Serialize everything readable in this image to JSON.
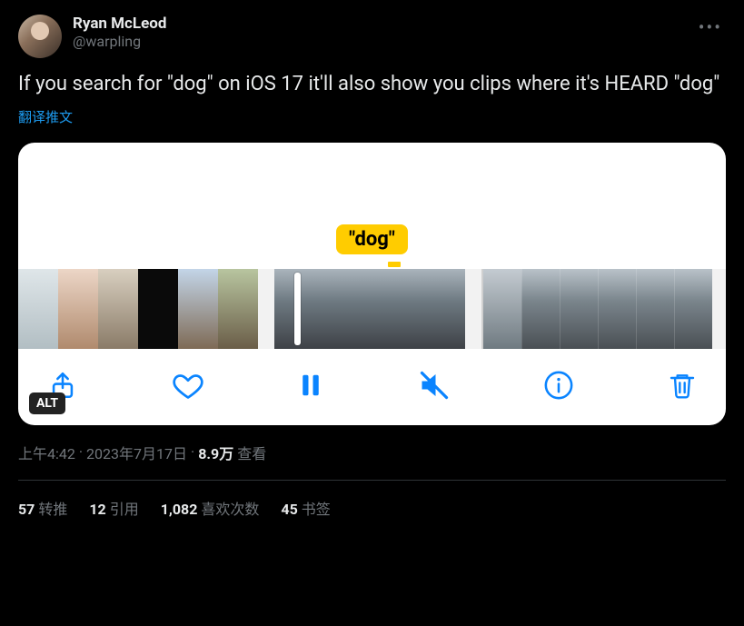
{
  "author": {
    "display_name": "Ryan McLeod",
    "handle": "@warpling"
  },
  "more_icon": "more-icon",
  "body": "If you search for \"dog\" on iOS 17 it'll also show you clips where it's HEARD \"dog\"",
  "translate_label": "翻译推文",
  "media": {
    "dog_label": "\"dog\"",
    "alt_badge": "ALT",
    "toolbar": {
      "share": "share",
      "heart": "heart",
      "pause": "pause",
      "mute": "mute",
      "info": "info",
      "trash": "trash"
    }
  },
  "meta": {
    "time": "上午4:42",
    "sep1": " · ",
    "date": "2023年7月17日",
    "sep2": " · ",
    "views_count": "8.9万",
    "views_label": " 查看"
  },
  "stats": {
    "retweets_count": "57",
    "retweets_label": "转推",
    "quotes_count": "12",
    "quotes_label": "引用",
    "likes_count": "1,082",
    "likes_label": "喜欢次数",
    "bookmarks_count": "45",
    "bookmarks_label": "书签"
  }
}
